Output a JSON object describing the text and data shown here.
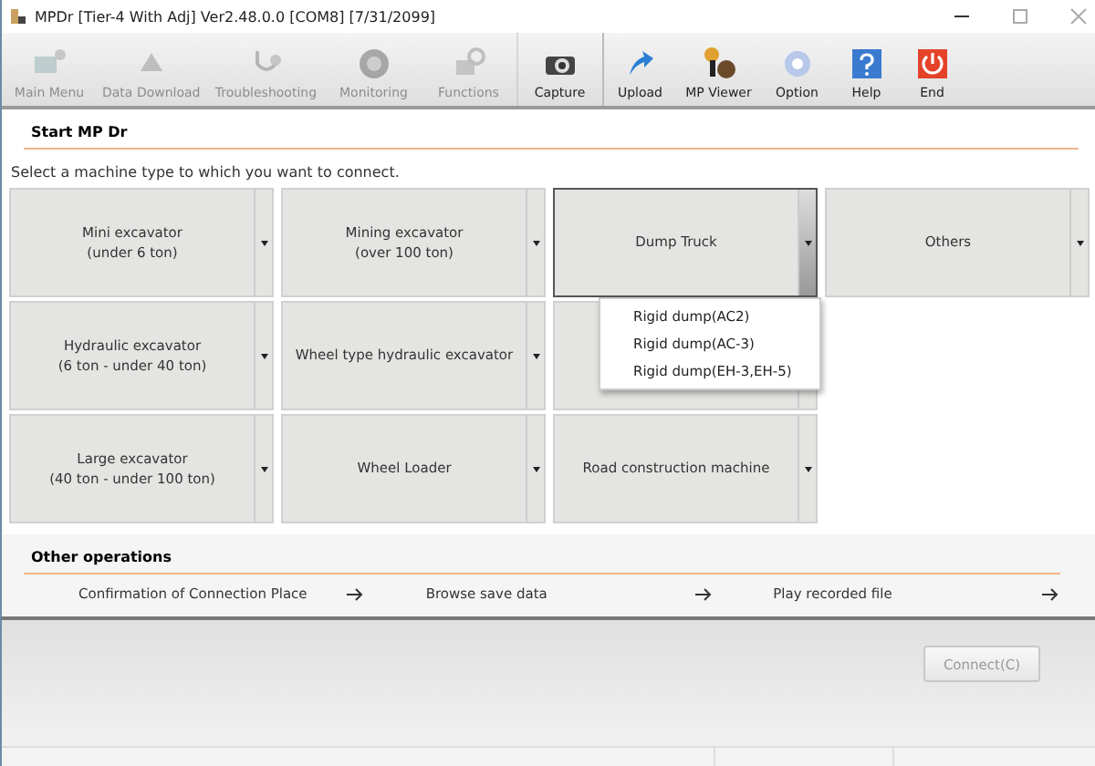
{
  "window": {
    "title": "MPDr [Tier-4 With Adj] Ver2.48.0.0 [COM8] [7/31/2099]"
  },
  "toolbar": [
    {
      "label": "Main Menu",
      "disabled": true
    },
    {
      "label": "Data Download",
      "disabled": true
    },
    {
      "label": "Troubleshooting",
      "disabled": true
    },
    {
      "label": "Monitoring",
      "disabled": true
    },
    {
      "label": "Functions",
      "disabled": true
    },
    {
      "label": "Capture",
      "disabled": false
    },
    {
      "label": "Upload",
      "disabled": false
    },
    {
      "label": "MP Viewer",
      "disabled": false
    },
    {
      "label": "Option",
      "disabled": false
    },
    {
      "label": "Help",
      "disabled": false
    },
    {
      "label": "End",
      "disabled": false
    }
  ],
  "start": {
    "title": "Start MP Dr",
    "instruction": "Select a machine type to which you want to connect."
  },
  "machines": [
    {
      "lines": [
        "Mini excavator",
        "(under 6 ton)"
      ],
      "selected": false,
      "expanded": false
    },
    {
      "lines": [
        "Mining excavator",
        "(over 100 ton)"
      ],
      "selected": false,
      "expanded": false
    },
    {
      "lines": [
        "Dump Truck"
      ],
      "selected": true,
      "expanded": true,
      "options": [
        "Rigid dump(AC2)",
        "Rigid dump(AC-3)",
        "Rigid dump(EH-3,EH-5)"
      ]
    },
    {
      "lines": [
        "Others"
      ],
      "selected": false,
      "expanded": false
    },
    {
      "lines": [
        "Hydraulic excavator",
        "(6 ton - under 40 ton)"
      ],
      "selected": false,
      "expanded": false
    },
    {
      "lines": [
        "Wheel type hydraulic excavator"
      ],
      "selected": false,
      "expanded": false
    },
    {
      "selected": false,
      "expanded": false
    },
    {
      "kind": "empty"
    },
    {
      "lines": [
        "Large excavator",
        "(40 ton - under 100 ton)"
      ],
      "selected": false,
      "expanded": false
    },
    {
      "lines": [
        "Wheel Loader"
      ],
      "selected": false,
      "expanded": false
    },
    {
      "lines": [
        "Road construction machine"
      ],
      "selected": false,
      "expanded": false
    }
  ],
  "other_operations": {
    "title": "Other operations",
    "links": [
      "Confirmation of Connection Place",
      "Browse save data",
      "Play recorded file"
    ]
  },
  "connect_button": {
    "label": "Connect(C)",
    "disabled": true
  }
}
